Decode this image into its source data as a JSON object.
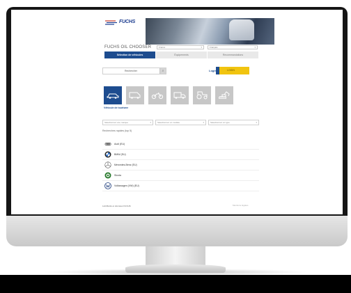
{
  "app": {
    "brand": "FUCHS",
    "title": "FUCHS OIL CHOOSER",
    "accent_color": "#1d4c8f",
    "highlight_color": "#f1c40f"
  },
  "header": {
    "country_select": "France",
    "language_select": "Français"
  },
  "tabs": [
    {
      "label": "Sélection de véhicules",
      "active": true
    },
    {
      "label": "Équipements",
      "active": false
    },
    {
      "label": "Recommandations",
      "active": false
    }
  ],
  "search": {
    "placeholder": "Rechercher",
    "button_icon": "search-icon"
  },
  "login": {
    "label": "Login",
    "toggle_text": "LOGIN"
  },
  "categories": [
    {
      "name": "car",
      "icon": "car-icon",
      "active": true
    },
    {
      "name": "van",
      "icon": "van-icon",
      "active": false
    },
    {
      "name": "motorcycle",
      "icon": "motorcycle-icon",
      "active": false
    },
    {
      "name": "truck",
      "icon": "truck-icon",
      "active": false
    },
    {
      "name": "tractor",
      "icon": "tractor-icon",
      "active": false
    },
    {
      "name": "construction",
      "icon": "excavator-icon",
      "active": false
    }
  ],
  "category_selected_label": "Véhicule de tourisme",
  "filters": [
    {
      "label": "Sélectionnez une marque"
    },
    {
      "label": "Sélectionnez un modèle"
    },
    {
      "label": "Sélectionnez un type"
    }
  ],
  "recent": {
    "title": "Recherches rapides (top 5)",
    "items": [
      {
        "name": "Audi (EU)",
        "icon": "audi-logo-icon"
      },
      {
        "name": "BMW (EU)",
        "icon": "bmw-logo-icon"
      },
      {
        "name": "Mercedes-Benz (EU)",
        "icon": "mercedes-logo-icon"
      },
      {
        "name": "Skoda",
        "icon": "skoda-logo-icon"
      },
      {
        "name": "Volkswagen (VW) (EU)",
        "icon": "vw-logo-icon"
      }
    ]
  },
  "footer": {
    "left": "Lubrifiants et données FUCHS",
    "right": "Mentions légales"
  }
}
